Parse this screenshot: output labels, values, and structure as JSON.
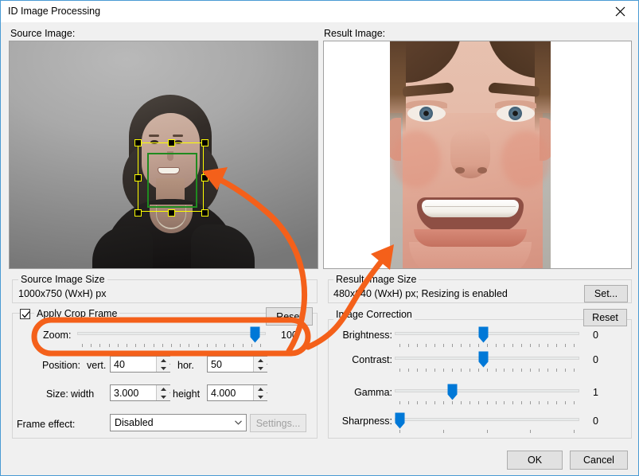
{
  "window": {
    "title": "ID Image Processing",
    "close_icon": "close-icon",
    "border_color": "#4a9bd4",
    "background": "#f0f0f0"
  },
  "panels": {
    "source_label": "Source Image:",
    "result_label": "Result Image:"
  },
  "source_group": {
    "title": "Source Image Size",
    "value": "1000x750 (WxH) px"
  },
  "crop_group": {
    "checkbox_label": "Apply Crop Frame",
    "checked": true,
    "reset_label": "Reset",
    "zoom": {
      "label": "Zoom:",
      "value": "100",
      "percent": 97
    },
    "position": {
      "label": "Position:",
      "vert_label": "vert.",
      "vert_value": "40",
      "hor_label": "hor.",
      "hor_value": "50"
    },
    "size": {
      "label": "Size:",
      "width_label": "width",
      "width_value": "3.000",
      "height_label": "height",
      "height_value": "4.000"
    },
    "frame_effect": {
      "label": "Frame effect:",
      "selected": "Disabled",
      "settings_label": "Settings...",
      "settings_disabled": true
    }
  },
  "result_group": {
    "title": "Result Image Size",
    "value": "480x640 (WxH) px; Resizing is enabled",
    "set_label": "Set..."
  },
  "correction_group": {
    "title": "Image Correction",
    "reset_label": "Reset",
    "sliders": [
      {
        "label": "Brightness:",
        "value": "0",
        "percent": 48
      },
      {
        "label": "Contrast:",
        "value": "0",
        "percent": 48
      },
      {
        "label": "Gamma:",
        "value": "1",
        "percent": 30
      },
      {
        "label": "Sharpness:",
        "value": "0",
        "percent": 0
      }
    ]
  },
  "footer": {
    "ok_label": "OK",
    "cancel_label": "Cancel"
  },
  "annotations": {
    "color": "#f4601a",
    "highlight_target": "zoom-slider-row",
    "arrow_1_target": "crop-frame",
    "arrow_2_target": "result-image"
  },
  "overlays": {
    "crop_frame_color": "#ffff00",
    "face_rect_color": "#1f8b1f",
    "handle_color": "#000000"
  }
}
